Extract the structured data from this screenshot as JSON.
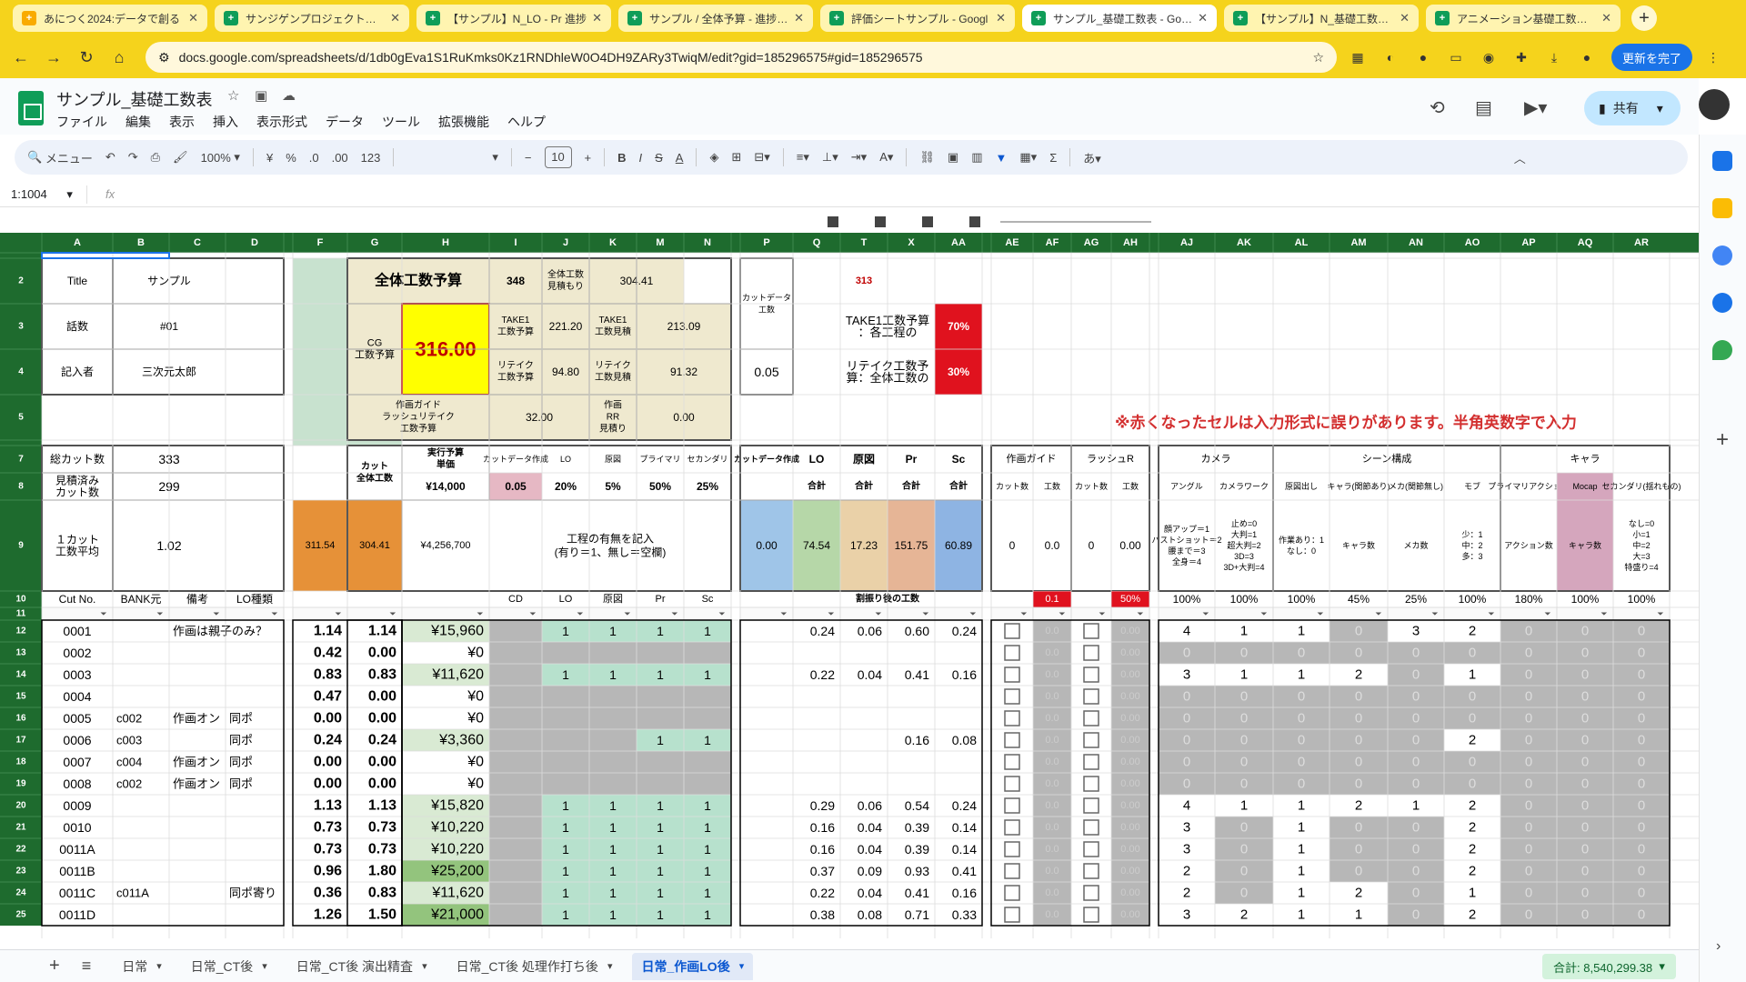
{
  "browser": {
    "tabs": [
      {
        "label": "あにつく2024:データで創る",
        "color": "#f9ab00",
        "active": false
      },
      {
        "label": "サンジゲンプロジェクト進捗",
        "color": "#0f9d58",
        "active": false
      },
      {
        "label": "【サンプル】N_LO - Pr 進捗",
        "color": "#0f9d58",
        "active": false
      },
      {
        "label": "サンプル / 全体予算 - 進捗 - C",
        "color": "#0f9d58",
        "active": false
      },
      {
        "label": "評価シートサンプル - Googl",
        "color": "#0f9d58",
        "active": false
      },
      {
        "label": "サンプル_基礎工数表 - Goog",
        "color": "#0f9d58",
        "active": true
      },
      {
        "label": "【サンプル】N_基礎工数表シ",
        "color": "#0f9d58",
        "active": false
      },
      {
        "label": "アニメーション基礎工数表マ",
        "color": "#0f9d58",
        "active": false
      }
    ],
    "url": "docs.google.com/spreadsheets/d/1db0gEva1S1RuKmks0Kz1RNDhleW0O4DH9ZARy3TwiqM/edit?gid=185296575#gid=185296575",
    "update_label": "更新を完了"
  },
  "sheets": {
    "title": "サンプル_基礎工数表",
    "menu": [
      "ファイル",
      "編集",
      "表示",
      "挿入",
      "表示形式",
      "データ",
      "ツール",
      "拡張機能",
      "ヘルプ"
    ],
    "share_label": "共有",
    "toolbar": {
      "menu_search": "メニュー",
      "zoom": "100%",
      "currency": "¥",
      "percent": "%",
      "dec_minus": ".0",
      "dec_plus": ".00",
      "number_format": "123",
      "font_size": "10"
    },
    "namebox": "1:1004",
    "fx": "fx",
    "sheet_tabs": [
      "日常",
      "日常_CT後",
      "日常_CT後 演出精査",
      "日常_CT後 処理作打ち後",
      "日常_作画LO後"
    ],
    "sum_label": "合計: 8,540,299.38"
  },
  "grid": {
    "col_headers": [
      "A",
      "B",
      "C",
      "D",
      "E",
      "F",
      "G",
      "H",
      "I",
      "J",
      "K",
      "M",
      "N",
      "O",
      "P",
      "Q",
      "T",
      "X",
      "AA",
      "AD",
      "AE",
      "AF",
      "AG",
      "AH",
      "AI",
      "AJ",
      "AK",
      "AL",
      "AM",
      "AN",
      "AO",
      "AP",
      "AQ",
      "AR"
    ],
    "row_headers": [
      "1",
      "2",
      "3",
      "4",
      "5",
      "6",
      "7",
      "8",
      "9",
      "10",
      "11",
      "12",
      "13",
      "14",
      "15",
      "16",
      "17",
      "18",
      "19",
      "20",
      "21",
      "22",
      "23",
      "24",
      "25"
    ],
    "summary": {
      "title_label": "Title",
      "title_value": "サンプル",
      "ep_label": "話数",
      "ep_value": "#01",
      "author_label": "記入者",
      "author_value": "三次元太郎",
      "total_budget_label": "全体工数予算",
      "total_budget_value": "348",
      "total_estimate_label": "全体工数見積もり",
      "total_estimate_value": "304.41",
      "cg_label": "CG工数予算",
      "cg_value": "316.00",
      "take1_budget_label": "TAKE1工数予算",
      "take1_budget_value": "221.20",
      "take1_est_label": "TAKE1工数見積",
      "take1_est_value": "213.09",
      "retake_budget_label": "リテイク工数予算",
      "retake_budget_value": "94.80",
      "retake_est_label": "リテイク工数見積",
      "retake_est_value": "91.32",
      "guide_label": "作画ガイドラッシュリテイク工数予算",
      "guide_value": "32.00",
      "rr_label": "作画RR見積り",
      "rr_value": "0.00",
      "cutdata_label": "カットデータ工数",
      "cutdata_value": "0.05",
      "p313": "313",
      "take1_ratio_label": "TAKE1工数予算：各工程の",
      "take1_ratio": "70%",
      "retake_ratio_label": "リテイク工数予算：全体工数の",
      "retake_ratio": "30%",
      "warning": "※赤くなったセルは入力形式に誤りがあります。半角英数字で入力",
      "total_cuts_label": "総カット数",
      "total_cuts": "333",
      "est_cuts_label": "見積済みカット数",
      "est_cuts": "299",
      "avg_label": "１カット工数平均",
      "avg_value": "1.02",
      "cut_total_label": "カット全体工数",
      "unit_price_label": "実行予算単価",
      "unit_price": "¥14,000",
      "rate_headers": [
        "カットデータ作成",
        "LO",
        "原図",
        "プライマリ",
        "セカンダリ"
      ],
      "rates": [
        "0.05",
        "20%",
        "5%",
        "50%",
        "25%"
      ],
      "f9": "311.54",
      "g9": "304.41",
      "h9": "¥4,256,700",
      "process_note": "工程の有無を記入\n(有り＝1、無し＝空欄)",
      "alloc_headers": [
        "カットデータ作成",
        "LO",
        "原図",
        "Pr",
        "Sc"
      ],
      "alloc_sub": [
        "合計",
        "合計",
        "合計",
        "合計"
      ],
      "alloc_values": [
        "0.00",
        "74.54",
        "17.23",
        "151.75",
        "60.89"
      ],
      "alloc_after_label": "割振り後の工数",
      "guide_group": "作画ガイド",
      "rush_group": "ラッシュR",
      "guide_sub": [
        "カット数",
        "工数",
        "カット数",
        "工数"
      ],
      "guide_values": [
        "0",
        "0.0",
        "0",
        "0.00"
      ],
      "ratio_row10_guide": "0.1",
      "ratio_row10_rush": "50%",
      "camera_group": "カメラ",
      "scene_group": "シーン構成",
      "chara_group": "キャラ",
      "right_headers": [
        "アングル",
        "カメラワーク",
        "原図出し",
        "キャラ(関節あり)",
        "メカ(関節無し)",
        "モブ",
        "プライマリアクション",
        "Mocap",
        "セカンダリ(揺れもの)"
      ],
      "right_notes": [
        "顔アップ＝1\nバストショット＝2\n腰まで＝3\n全身＝4",
        "止め=0\n大判=1\n超大判=2\n3D=3\n3D+大判=4",
        "作業あり：1\nなし：0",
        "キャラ数",
        "メカ数",
        "少：1\n中：2\n多：3",
        "アクション数",
        "キャラ数",
        "なし=0\n小=1\n中=2\n大=3\n特盛り=4"
      ],
      "right_pct": [
        "100%",
        "100%",
        "100%",
        "45%",
        "25%",
        "100%",
        "180%",
        "100%",
        "100%"
      ],
      "row10_headers": [
        "Cut No.",
        "BANK元",
        "備考",
        "LO種類",
        "CD",
        "LO",
        "原図",
        "Pr",
        "Sc"
      ]
    },
    "rows": [
      {
        "row": "12",
        "cut": "0001",
        "bank": "",
        "note": "作画は親子のみ？",
        "lo": "",
        "f": "1.14",
        "g": "1.14",
        "h": "¥15,960",
        "flags": [
          "1",
          "1",
          "1",
          "1"
        ],
        "alloc": [
          "0.24",
          "0.06",
          "0.60",
          "0.24"
        ],
        "right": [
          "4",
          "1",
          "1",
          "0",
          "3",
          "2",
          "0",
          "0",
          "0"
        ]
      },
      {
        "row": "13",
        "cut": "0002",
        "bank": "",
        "note": "",
        "lo": "",
        "f": "0.42",
        "g": "0.00",
        "h": "¥0",
        "flags": [
          "",
          "",
          "",
          ""
        ],
        "alloc": [
          "",
          "",
          "",
          ""
        ],
        "right": [
          "0",
          "0",
          "0",
          "0",
          "0",
          "0",
          "0",
          "0",
          "0"
        ]
      },
      {
        "row": "14",
        "cut": "0003",
        "bank": "",
        "note": "",
        "lo": "",
        "f": "0.83",
        "g": "0.83",
        "h": "¥11,620",
        "flags": [
          "1",
          "1",
          "1",
          "1"
        ],
        "alloc": [
          "0.22",
          "0.04",
          "0.41",
          "0.16"
        ],
        "right": [
          "3",
          "1",
          "1",
          "2",
          "0",
          "1",
          "0",
          "0",
          "0"
        ]
      },
      {
        "row": "15",
        "cut": "0004",
        "bank": "",
        "note": "",
        "lo": "",
        "f": "0.47",
        "g": "0.00",
        "h": "¥0",
        "flags": [
          "",
          "",
          "",
          ""
        ],
        "alloc": [
          "",
          "",
          "",
          ""
        ],
        "right": [
          "0",
          "0",
          "0",
          "0",
          "0",
          "0",
          "0",
          "0",
          "0"
        ]
      },
      {
        "row": "16",
        "cut": "0005",
        "bank": "c002",
        "note": "作画オン",
        "lo": "同ポ",
        "f": "0.00",
        "g": "0.00",
        "h": "¥0",
        "flags": [
          "",
          "",
          "",
          ""
        ],
        "alloc": [
          "",
          "",
          "",
          ""
        ],
        "right": [
          "0",
          "0",
          "0",
          "0",
          "0",
          "0",
          "0",
          "0",
          "0"
        ]
      },
      {
        "row": "17",
        "cut": "0006",
        "bank": "c003",
        "note": "",
        "lo": "同ポ",
        "f": "0.24",
        "g": "0.24",
        "h": "¥3,360",
        "flags": [
          "",
          "",
          "1",
          "1"
        ],
        "alloc": [
          "",
          "",
          "0.16",
          "0.08"
        ],
        "right": [
          "0",
          "0",
          "0",
          "0",
          "0",
          "2",
          "0",
          "0",
          "0"
        ]
      },
      {
        "row": "18",
        "cut": "0007",
        "bank": "c004",
        "note": "作画オン",
        "lo": "同ポ",
        "f": "0.00",
        "g": "0.00",
        "h": "¥0",
        "flags": [
          "",
          "",
          "",
          ""
        ],
        "alloc": [
          "",
          "",
          "",
          ""
        ],
        "right": [
          "0",
          "0",
          "0",
          "0",
          "0",
          "0",
          "0",
          "0",
          "0"
        ]
      },
      {
        "row": "19",
        "cut": "0008",
        "bank": "c002",
        "note": "作画オン",
        "lo": "同ポ",
        "f": "0.00",
        "g": "0.00",
        "h": "¥0",
        "flags": [
          "",
          "",
          "",
          ""
        ],
        "alloc": [
          "",
          "",
          "",
          ""
        ],
        "right": [
          "0",
          "0",
          "0",
          "0",
          "0",
          "0",
          "0",
          "0",
          "0"
        ]
      },
      {
        "row": "20",
        "cut": "0009",
        "bank": "",
        "note": "",
        "lo": "",
        "f": "1.13",
        "g": "1.13",
        "h": "¥15,820",
        "flags": [
          "1",
          "1",
          "1",
          "1"
        ],
        "alloc": [
          "0.29",
          "0.06",
          "0.54",
          "0.24"
        ],
        "right": [
          "4",
          "1",
          "1",
          "2",
          "1",
          "2",
          "0",
          "0",
          "0"
        ]
      },
      {
        "row": "21",
        "cut": "0010",
        "bank": "",
        "note": "",
        "lo": "",
        "f": "0.73",
        "g": "0.73",
        "h": "¥10,220",
        "flags": [
          "1",
          "1",
          "1",
          "1"
        ],
        "alloc": [
          "0.16",
          "0.04",
          "0.39",
          "0.14"
        ],
        "right": [
          "3",
          "0",
          "1",
          "0",
          "0",
          "2",
          "0",
          "0",
          "0"
        ]
      },
      {
        "row": "22",
        "cut": "0011A",
        "bank": "",
        "note": "",
        "lo": "",
        "f": "0.73",
        "g": "0.73",
        "h": "¥10,220",
        "flags": [
          "1",
          "1",
          "1",
          "1"
        ],
        "alloc": [
          "0.16",
          "0.04",
          "0.39",
          "0.14"
        ],
        "right": [
          "3",
          "0",
          "1",
          "0",
          "0",
          "2",
          "0",
          "0",
          "0"
        ]
      },
      {
        "row": "23",
        "cut": "0011B",
        "bank": "",
        "note": "",
        "lo": "",
        "f": "0.96",
        "g": "1.80",
        "h": "¥25,200",
        "flags": [
          "1",
          "1",
          "1",
          "1"
        ],
        "alloc": [
          "0.37",
          "0.09",
          "0.93",
          "0.41"
        ],
        "right": [
          "2",
          "0",
          "1",
          "0",
          "0",
          "2",
          "0",
          "0",
          "0"
        ]
      },
      {
        "row": "24",
        "cut": "0011C",
        "bank": "c011A",
        "note": "",
        "lo": "同ポ寄り",
        "f": "0.36",
        "g": "0.83",
        "h": "¥11,620",
        "flags": [
          "1",
          "1",
          "1",
          "1"
        ],
        "alloc": [
          "0.22",
          "0.04",
          "0.41",
          "0.16"
        ],
        "right": [
          "2",
          "0",
          "1",
          "2",
          "0",
          "1",
          "0",
          "0",
          "0"
        ]
      },
      {
        "row": "25",
        "cut": "0011D",
        "bank": "",
        "note": "",
        "lo": "",
        "f": "1.26",
        "g": "1.50",
        "h": "¥21,000",
        "flags": [
          "1",
          "1",
          "1",
          "1"
        ],
        "alloc": [
          "0.38",
          "0.08",
          "0.71",
          "0.33"
        ],
        "right": [
          "3",
          "2",
          "1",
          "1",
          "0",
          "2",
          "0",
          "0",
          "0"
        ]
      }
    ]
  }
}
